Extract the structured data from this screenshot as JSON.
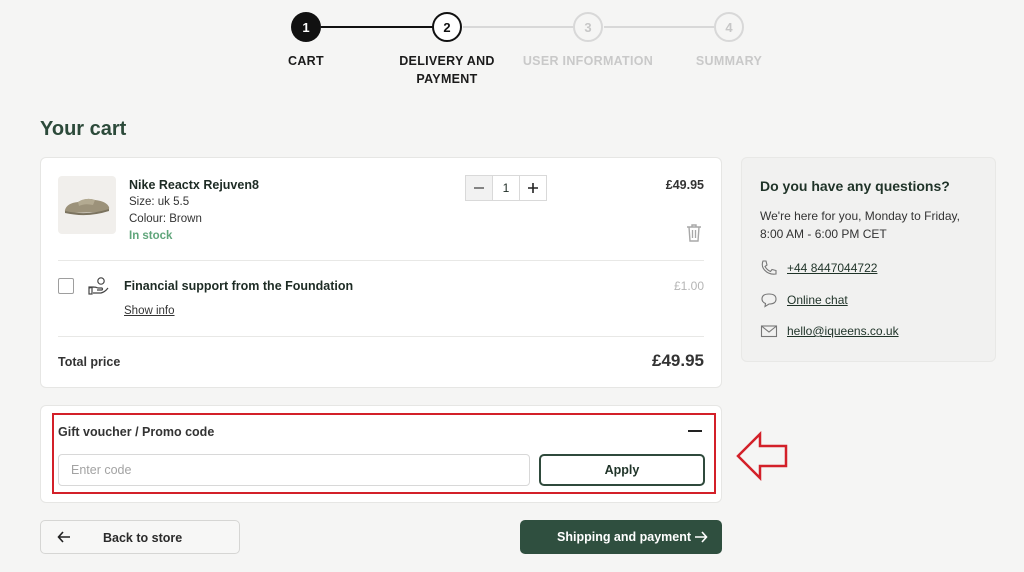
{
  "stepper": {
    "steps": [
      {
        "number": "1",
        "label": "CART",
        "state": "done"
      },
      {
        "number": "2",
        "label": "DELIVERY AND PAYMENT",
        "state": "current"
      },
      {
        "number": "3",
        "label": "USER INFORMATION",
        "state": "future"
      },
      {
        "number": "4",
        "label": "SUMMARY",
        "state": "future"
      }
    ]
  },
  "page": {
    "title": "Your cart"
  },
  "cart": {
    "item": {
      "name": "Nike Reactx Rejuven8",
      "size": "Size: uk 5.5",
      "colour": "Colour: Brown",
      "stock": "In stock",
      "quantity": "1",
      "price": "£49.95",
      "icons": {
        "minus": "minus-icon",
        "plus": "plus-icon",
        "delete": "trash-icon"
      }
    },
    "support": {
      "title": "Financial support from the Foundation",
      "show_info": "Show info",
      "price": "£1.00",
      "icon": "hand-coin-icon"
    },
    "total_label": "Total price",
    "total_value": "£49.95"
  },
  "promo": {
    "title": "Gift voucher / Promo code",
    "placeholder": "Enter code",
    "value": "",
    "apply_label": "Apply",
    "highlight_color": "#d32029"
  },
  "actions": {
    "back_label": "Back to store",
    "next_label": "Shipping and payment"
  },
  "help": {
    "title": "Do you have any questions?",
    "text": "We're here for you, Monday to Friday, 8:00 AM - 6:00 PM CET",
    "phone": "+44 8447044722",
    "chat": "Online chat",
    "email": "hello@iqueens.co.uk"
  },
  "colors": {
    "brand": "#2f4f3f",
    "stock": "#5fa57a",
    "background": "#f5f5f4"
  }
}
